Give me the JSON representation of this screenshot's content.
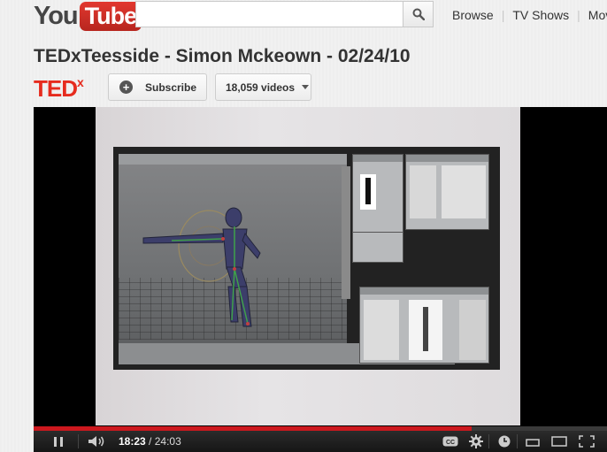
{
  "header": {
    "logo_you": "You",
    "logo_tube": "Tube",
    "search_placeholder": "",
    "search_icon": "magnifier-icon",
    "nav": [
      "Browse",
      "TV Shows",
      "Mov"
    ]
  },
  "video": {
    "title": "TEDxTeesside - Simon Mckeown - 02/24/10"
  },
  "channel": {
    "logo_main": "TED",
    "logo_sup": "x",
    "subscribe_label": "Subscribe",
    "videos_label": "18,059 videos"
  },
  "player": {
    "current_time": "18:23",
    "separator": "/",
    "duration": "24:03",
    "progress_fraction": 0.764,
    "accent_color": "#cc181e",
    "icons": [
      "pause-icon",
      "volume-icon",
      "closed-captions-icon",
      "gear-icon",
      "clock-icon",
      "small-player-icon",
      "large-player-icon",
      "fullscreen-icon"
    ]
  }
}
